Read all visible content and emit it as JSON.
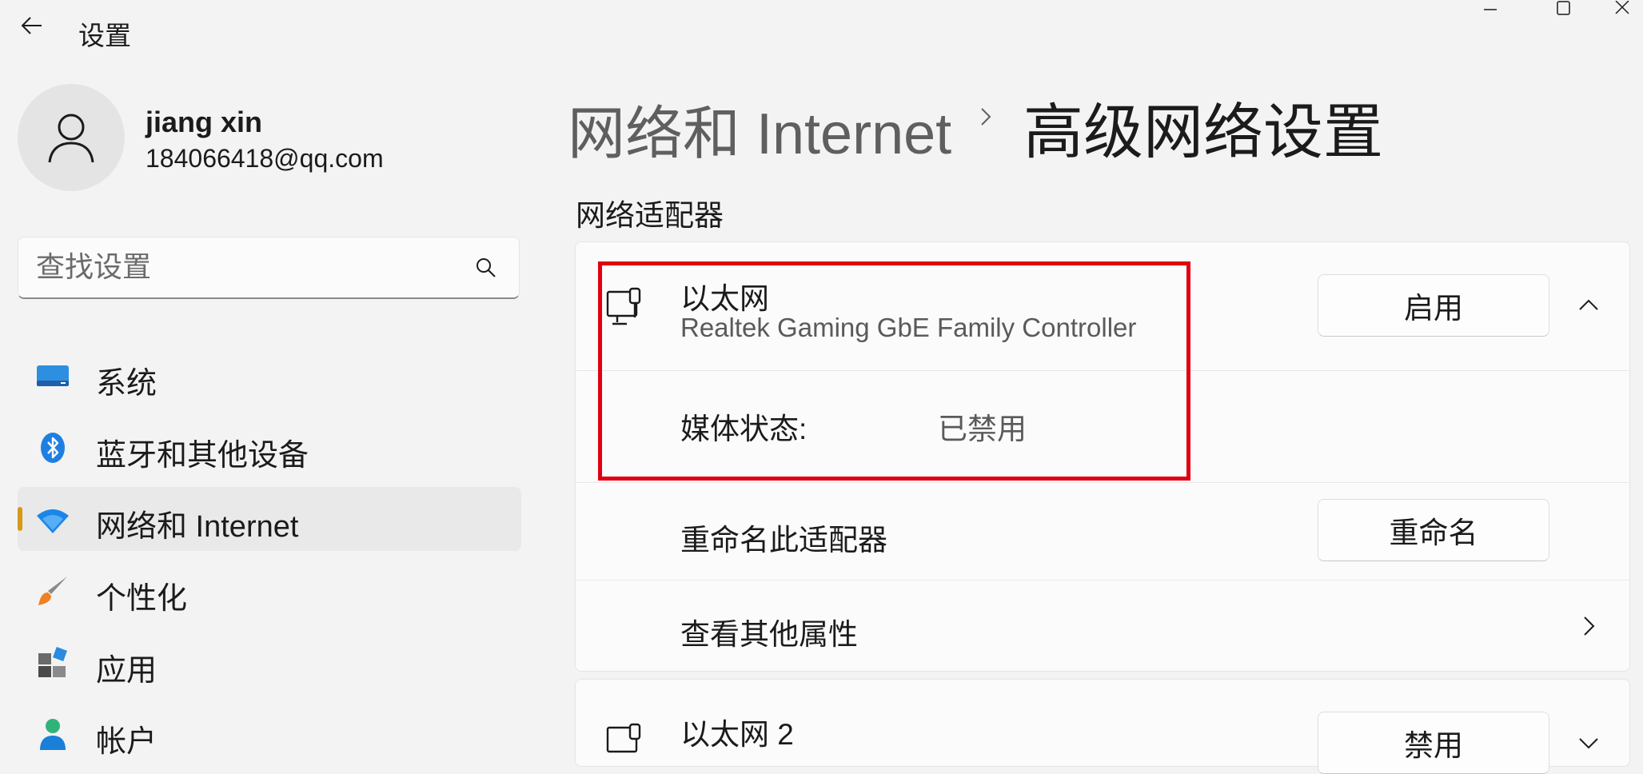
{
  "window": {
    "title": "设置",
    "controls": [
      "minimize-icon",
      "maximize-icon",
      "close-icon"
    ]
  },
  "profile": {
    "name": "jiang xin",
    "email": "184066418@qq.com"
  },
  "search": {
    "placeholder": "查找设置"
  },
  "sidebar": {
    "items": [
      {
        "label": "系统",
        "icon": "system-icon"
      },
      {
        "label": "蓝牙和其他设备",
        "icon": "bluetooth-icon"
      },
      {
        "label": "网络和 Internet",
        "icon": "wifi-icon",
        "active": true
      },
      {
        "label": "个性化",
        "icon": "brush-icon"
      },
      {
        "label": "应用",
        "icon": "apps-icon"
      },
      {
        "label": "帐户",
        "icon": "account-icon"
      }
    ]
  },
  "header": {
    "parent": "网络和 Internet",
    "title": "高级网络设置"
  },
  "adapters_section": {
    "title": "网络适配器"
  },
  "adapter1": {
    "name": "以太网",
    "description": "Realtek Gaming GbE Family Controller",
    "action_label": "启用",
    "expanded": true,
    "media_status_label": "媒体状态:",
    "media_status_value": "已禁用",
    "rename_label": "重命名此适配器",
    "rename_button": "重命名",
    "more_props_label": "查看其他属性"
  },
  "adapter2": {
    "name": "以太网 2",
    "action_label": "禁用"
  },
  "colors": {
    "accent": "#d49a18",
    "highlight": "#e00010",
    "background": "#f3f3f3"
  }
}
